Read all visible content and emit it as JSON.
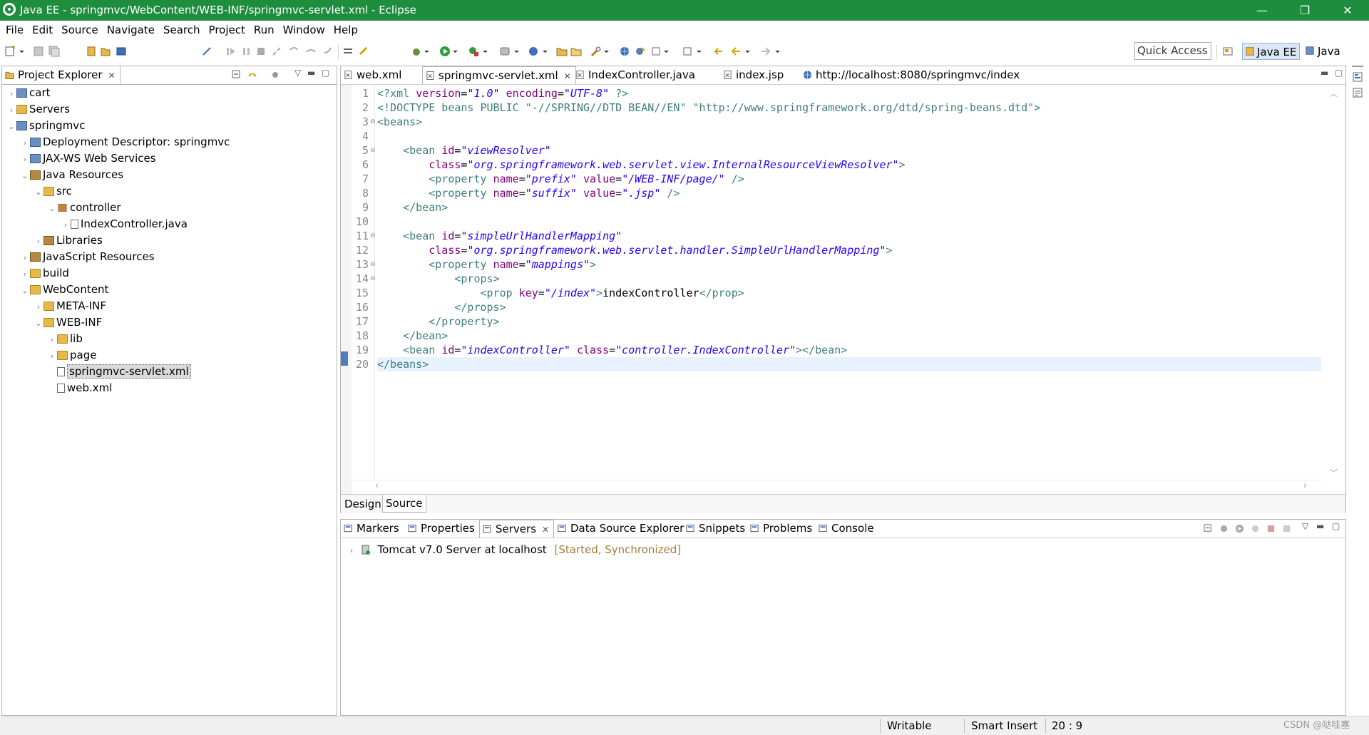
{
  "window": {
    "title": "Java EE - springmvc/WebContent/WEB-INF/springmvc-servlet.xml - Eclipse",
    "controls": [
      "—",
      "❐",
      "✕"
    ]
  },
  "menu": [
    "File",
    "Edit",
    "Source",
    "Navigate",
    "Search",
    "Project",
    "Run",
    "Window",
    "Help"
  ],
  "toolbar": {
    "quick_access": "Quick Access",
    "perspectives": [
      "Java EE",
      "Java"
    ]
  },
  "project_explorer": {
    "title": "Project Explorer",
    "tree": [
      {
        "label": "cart",
        "depth": 0,
        "twisty": "›",
        "icon": "project-icon"
      },
      {
        "label": "Servers",
        "depth": 0,
        "twisty": "›",
        "icon": "folder-icon"
      },
      {
        "label": "springmvc",
        "depth": 0,
        "twisty": "⌄",
        "icon": "project-icon"
      },
      {
        "label": "Deployment Descriptor: springmvc",
        "depth": 1,
        "twisty": "›",
        "icon": "descriptor-icon"
      },
      {
        "label": "JAX-WS Web Services",
        "depth": 1,
        "twisty": "›",
        "icon": "webservice-icon"
      },
      {
        "label": "Java Resources",
        "depth": 1,
        "twisty": "⌄",
        "icon": "java-resources-icon"
      },
      {
        "label": "src",
        "depth": 2,
        "twisty": "⌄",
        "icon": "source-folder-icon"
      },
      {
        "label": "controller",
        "depth": 3,
        "twisty": "⌄",
        "icon": "package-icon"
      },
      {
        "label": "IndexController.java",
        "depth": 4,
        "twisty": "›",
        "icon": "java-file-icon"
      },
      {
        "label": "Libraries",
        "depth": 2,
        "twisty": "›",
        "icon": "library-icon"
      },
      {
        "label": "JavaScript Resources",
        "depth": 1,
        "twisty": "›",
        "icon": "js-resources-icon"
      },
      {
        "label": "build",
        "depth": 1,
        "twisty": "›",
        "icon": "folder-icon"
      },
      {
        "label": "WebContent",
        "depth": 1,
        "twisty": "⌄",
        "icon": "folder-icon"
      },
      {
        "label": "META-INF",
        "depth": 2,
        "twisty": "›",
        "icon": "folder-icon"
      },
      {
        "label": "WEB-INF",
        "depth": 2,
        "twisty": "⌄",
        "icon": "folder-icon"
      },
      {
        "label": "lib",
        "depth": 3,
        "twisty": "›",
        "icon": "folder-icon"
      },
      {
        "label": "page",
        "depth": 3,
        "twisty": "›",
        "icon": "folder-icon"
      },
      {
        "label": "springmvc-servlet.xml",
        "depth": 3,
        "twisty": "",
        "icon": "xml-file-icon",
        "selected": true
      },
      {
        "label": "web.xml",
        "depth": 3,
        "twisty": "",
        "icon": "xml-file-icon"
      }
    ]
  },
  "editor": {
    "tabs": [
      {
        "label": "web.xml",
        "icon": "xml-file-icon"
      },
      {
        "label": "springmvc-servlet.xml",
        "icon": "xml-file-icon",
        "active": true,
        "close": "✕"
      },
      {
        "label": "IndexController.java",
        "icon": "java-file-icon"
      },
      {
        "label": "index.jsp",
        "icon": "jsp-file-icon"
      },
      {
        "label": "http://localhost:8080/springmvc/index",
        "icon": "globe-icon"
      }
    ],
    "current_line": 20,
    "lines": [
      {
        "n": "1",
        "fold": "",
        "tokens": [
          [
            "c-proc",
            "<?xml "
          ],
          [
            "c-attr",
            "version"
          ],
          [
            "c-text",
            "="
          ],
          [
            "c-val",
            "\"1.0\""
          ],
          [
            "c-text",
            " "
          ],
          [
            "c-attr",
            "encoding"
          ],
          [
            "c-text",
            "="
          ],
          [
            "c-val",
            "\"UTF-8\""
          ],
          [
            "c-proc",
            " ?>"
          ]
        ]
      },
      {
        "n": "2",
        "fold": "",
        "tokens": [
          [
            "c-tag",
            "<!DOCTYPE beans PUBLIC "
          ],
          [
            "c-tag",
            "\"-//SPRING//DTD BEAN//EN\" \"http://www.springframework.org/dtd/spring-beans.dtd\">"
          ]
        ]
      },
      {
        "n": "3",
        "fold": "⊖",
        "tokens": [
          [
            "c-tag",
            "<beans>"
          ]
        ]
      },
      {
        "n": "4",
        "fold": "",
        "tokens": []
      },
      {
        "n": "5",
        "fold": "⊖",
        "tokens": [
          [
            "c-text",
            "    "
          ],
          [
            "c-tag",
            "<bean "
          ],
          [
            "c-attr",
            "id"
          ],
          [
            "c-text",
            "="
          ],
          [
            "c-val",
            "\"viewResolver\""
          ]
        ]
      },
      {
        "n": "6",
        "fold": "",
        "tokens": [
          [
            "c-text",
            "        "
          ],
          [
            "c-attr",
            "class"
          ],
          [
            "c-text",
            "="
          ],
          [
            "c-val",
            "\"org.springframework.web.servlet.view.InternalResourceViewResolver\""
          ],
          [
            "c-tag",
            ">"
          ]
        ]
      },
      {
        "n": "7",
        "fold": "",
        "tokens": [
          [
            "c-text",
            "        "
          ],
          [
            "c-tag",
            "<property "
          ],
          [
            "c-attr",
            "name"
          ],
          [
            "c-text",
            "="
          ],
          [
            "c-val",
            "\"prefix\""
          ],
          [
            "c-text",
            " "
          ],
          [
            "c-attr",
            "value"
          ],
          [
            "c-text",
            "="
          ],
          [
            "c-val",
            "\"/WEB-INF/page/\""
          ],
          [
            "c-tag",
            " />"
          ]
        ]
      },
      {
        "n": "8",
        "fold": "",
        "tokens": [
          [
            "c-text",
            "        "
          ],
          [
            "c-tag",
            "<property "
          ],
          [
            "c-attr",
            "name"
          ],
          [
            "c-text",
            "="
          ],
          [
            "c-val",
            "\"suffix\""
          ],
          [
            "c-text",
            " "
          ],
          [
            "c-attr",
            "value"
          ],
          [
            "c-text",
            "="
          ],
          [
            "c-val",
            "\".jsp\""
          ],
          [
            "c-tag",
            " />"
          ]
        ]
      },
      {
        "n": "9",
        "fold": "",
        "tokens": [
          [
            "c-text",
            "    "
          ],
          [
            "c-tag",
            "</bean>"
          ]
        ]
      },
      {
        "n": "10",
        "fold": "",
        "tokens": []
      },
      {
        "n": "11",
        "fold": "⊖",
        "tokens": [
          [
            "c-text",
            "    "
          ],
          [
            "c-tag",
            "<bean "
          ],
          [
            "c-attr",
            "id"
          ],
          [
            "c-text",
            "="
          ],
          [
            "c-val",
            "\"simpleUrlHandlerMapping\""
          ]
        ]
      },
      {
        "n": "12",
        "fold": "",
        "tokens": [
          [
            "c-text",
            "        "
          ],
          [
            "c-attr",
            "class"
          ],
          [
            "c-text",
            "="
          ],
          [
            "c-val",
            "\"org.springframework.web.servlet.handler.SimpleUrlHandlerMapping\""
          ],
          [
            "c-tag",
            ">"
          ]
        ]
      },
      {
        "n": "13",
        "fold": "⊖",
        "tokens": [
          [
            "c-text",
            "        "
          ],
          [
            "c-tag",
            "<property "
          ],
          [
            "c-attr",
            "name"
          ],
          [
            "c-text",
            "="
          ],
          [
            "c-val",
            "\"mappings\""
          ],
          [
            "c-tag",
            ">"
          ]
        ]
      },
      {
        "n": "14",
        "fold": "⊖",
        "tokens": [
          [
            "c-text",
            "            "
          ],
          [
            "c-tag",
            "<props>"
          ]
        ]
      },
      {
        "n": "15",
        "fold": "",
        "tokens": [
          [
            "c-text",
            "                "
          ],
          [
            "c-tag",
            "<prop "
          ],
          [
            "c-attr",
            "key"
          ],
          [
            "c-text",
            "="
          ],
          [
            "c-val",
            "\"/index\""
          ],
          [
            "c-tag",
            ">"
          ],
          [
            "c-text",
            "indexController"
          ],
          [
            "c-tag",
            "</prop>"
          ]
        ]
      },
      {
        "n": "16",
        "fold": "",
        "tokens": [
          [
            "c-text",
            "            "
          ],
          [
            "c-tag",
            "</props>"
          ]
        ]
      },
      {
        "n": "17",
        "fold": "",
        "tokens": [
          [
            "c-text",
            "        "
          ],
          [
            "c-tag",
            "</property>"
          ]
        ]
      },
      {
        "n": "18",
        "fold": "",
        "tokens": [
          [
            "c-text",
            "    "
          ],
          [
            "c-tag",
            "</bean>"
          ]
        ]
      },
      {
        "n": "19",
        "fold": "",
        "tokens": [
          [
            "c-text",
            "    "
          ],
          [
            "c-tag",
            "<bean "
          ],
          [
            "c-attr",
            "id"
          ],
          [
            "c-text",
            "="
          ],
          [
            "c-val",
            "\"indexController\""
          ],
          [
            "c-text",
            " "
          ],
          [
            "c-attr",
            "class"
          ],
          [
            "c-text",
            "="
          ],
          [
            "c-val",
            "\"controller.IndexController\""
          ],
          [
            "c-tag",
            "></bean>"
          ]
        ]
      },
      {
        "n": "20",
        "fold": "",
        "tokens": [
          [
            "c-tag",
            "</beans>"
          ]
        ]
      }
    ],
    "bottom_tabs": [
      "Design",
      "Source"
    ]
  },
  "bottom_panel": {
    "tabs": [
      "Markers",
      "Properties",
      "Servers",
      "Data Source Explorer",
      "Snippets",
      "Problems",
      "Console"
    ],
    "server_name": "Tomcat v7.0 Server at localhost",
    "server_status": "[Started, Synchronized]"
  },
  "status": {
    "writable": "Writable",
    "insert_mode": "Smart Insert",
    "position": "20 : 9",
    "watermark": "CSDN @哒哇塞"
  }
}
